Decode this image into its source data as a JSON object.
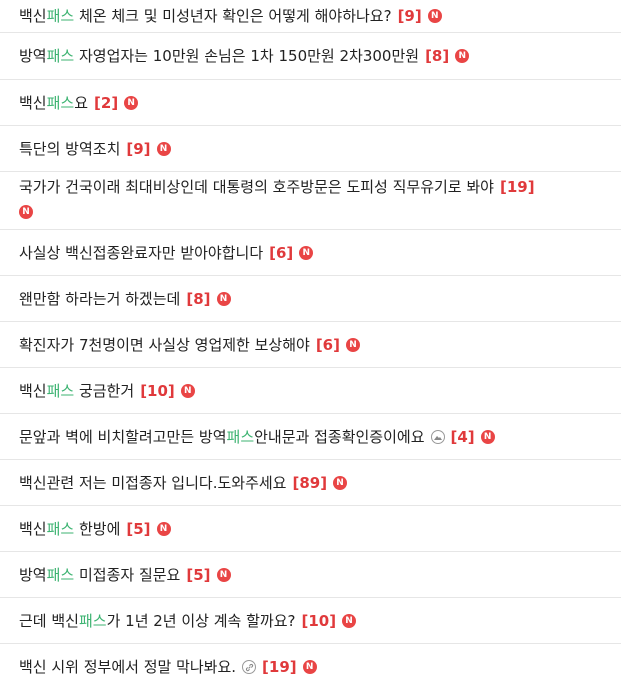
{
  "items": [
    {
      "pre": "백신",
      "hl": "패스",
      "post": " 체온 체크 및 미성년자 확인은 어떻게 해야하나요?",
      "count": "[9]",
      "att": "",
      "new": "N"
    },
    {
      "pre": "방역",
      "hl": "패스",
      "post": " 자영업자는 10만원 손님은 1차 150만원 2차300만원",
      "count": "[8]",
      "att": "",
      "new": "N"
    },
    {
      "pre": "백신",
      "hl": "패스",
      "post": "요",
      "count": "[2]",
      "att": "",
      "new": "N"
    },
    {
      "pre": "특단의 방역조치",
      "hl": "",
      "post": "",
      "count": "[9]",
      "att": "",
      "new": "N"
    },
    {
      "pre": "국가가 건국이래 최대비상인데 대통령의 호주방문은 도피성 직무유기로 봐야",
      "hl": "",
      "post": "",
      "count": "[19]",
      "att": "",
      "new": "N"
    },
    {
      "pre": "사실상 백신접종완료자만 받아야합니다",
      "hl": "",
      "post": "",
      "count": "[6]",
      "att": "",
      "new": "N"
    },
    {
      "pre": "왠만함 하라는거 하겠는데",
      "hl": "",
      "post": "",
      "count": "[8]",
      "att": "",
      "new": "N"
    },
    {
      "pre": "확진자가 7천명이면 사실상 영업제한 보상해야",
      "hl": "",
      "post": "",
      "count": "[6]",
      "att": "",
      "new": "N"
    },
    {
      "pre": "백신",
      "hl": "패스",
      "post": " 궁금한거",
      "count": "[10]",
      "att": "",
      "new": "N"
    },
    {
      "pre": "문앞과 벽에 비치할려고만든 방역",
      "hl": "패스",
      "post": "안내문과 접종확인증이에요",
      "count": "[4]",
      "att": "image",
      "new": "N"
    },
    {
      "pre": "백신관련 저는 미접종자 입니다.도와주세요",
      "hl": "",
      "post": "",
      "count": "[89]",
      "att": "",
      "new": "N"
    },
    {
      "pre": "백신",
      "hl": "패스",
      "post": " 한방에",
      "count": "[5]",
      "att": "",
      "new": "N"
    },
    {
      "pre": "방역",
      "hl": "패스",
      "post": " 미접종자 질문요",
      "count": "[5]",
      "att": "",
      "new": "N"
    },
    {
      "pre": "근데 백신",
      "hl": "패스",
      "post": "가 1년 2년 이상 계속 할까요?",
      "count": "[10]",
      "att": "",
      "new": "N"
    },
    {
      "pre": "백신 시위 정부에서 정말 막나봐요.",
      "hl": "",
      "post": "",
      "count": "[19]",
      "att": "link",
      "new": "N"
    }
  ]
}
